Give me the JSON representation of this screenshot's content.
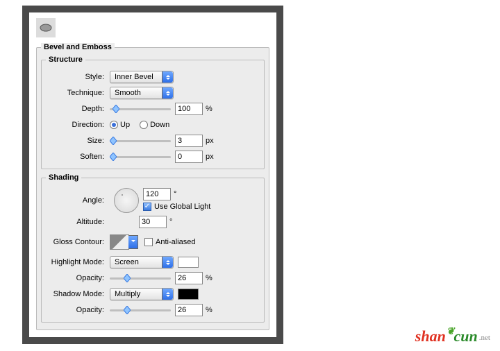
{
  "panel": {
    "title": "Bevel and Emboss"
  },
  "structure": {
    "legend": "Structure",
    "style_label": "Style:",
    "style_value": "Inner Bevel",
    "technique_label": "Technique:",
    "technique_value": "Smooth",
    "depth_label": "Depth:",
    "depth_value": "100",
    "depth_unit": "%",
    "direction_label": "Direction:",
    "direction_up": "Up",
    "direction_down": "Down",
    "direction_selected": "up",
    "size_label": "Size:",
    "size_value": "3",
    "size_unit": "px",
    "soften_label": "Soften:",
    "soften_value": "0",
    "soften_unit": "px"
  },
  "shading": {
    "legend": "Shading",
    "angle_label": "Angle:",
    "angle_value": "120",
    "angle_unit": "°",
    "use_global_light_label": "Use Global Light",
    "use_global_light_checked": true,
    "altitude_label": "Altitude:",
    "altitude_value": "30",
    "altitude_unit": "°",
    "gloss_contour_label": "Gloss Contour:",
    "antialiased_label": "Anti-aliased",
    "antialiased_checked": false,
    "highlight_mode_label": "Highlight Mode:",
    "highlight_mode_value": "Screen",
    "highlight_color": "#ffffff",
    "highlight_opacity_label": "Opacity:",
    "highlight_opacity_value": "26",
    "highlight_opacity_unit": "%",
    "shadow_mode_label": "Shadow Mode:",
    "shadow_mode_value": "Multiply",
    "shadow_color": "#000000",
    "shadow_opacity_label": "Opacity:",
    "shadow_opacity_value": "26",
    "shadow_opacity_unit": "%"
  },
  "watermark": {
    "part1": "shan",
    "part2": "cun",
    "suffix": ".net"
  }
}
